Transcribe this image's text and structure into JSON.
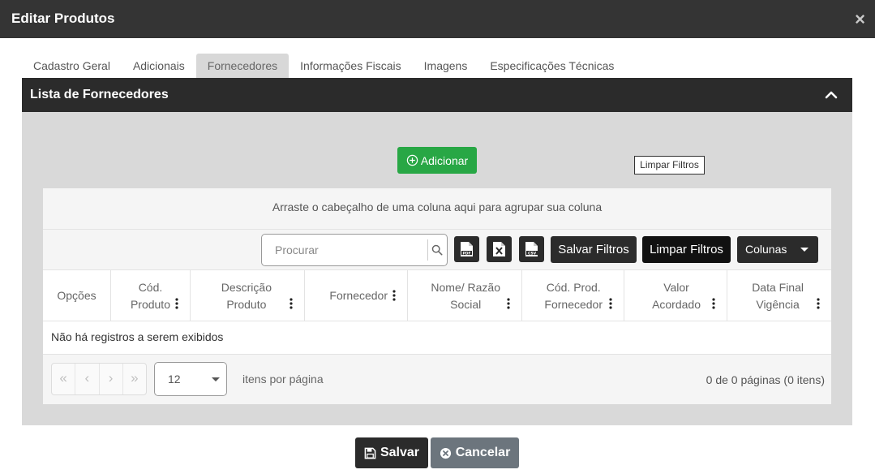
{
  "modal": {
    "title": "Editar Produtos",
    "close": "×"
  },
  "tabs": [
    {
      "label": "Cadastro Geral",
      "active": false
    },
    {
      "label": "Adicionais",
      "active": false
    },
    {
      "label": "Fornecedores",
      "active": true
    },
    {
      "label": "Informações Fiscais",
      "active": false
    },
    {
      "label": "Imagens",
      "active": false
    },
    {
      "label": "Especificações Técnicas",
      "active": false
    }
  ],
  "panel": {
    "title": "Lista de Fornecedores"
  },
  "actions": {
    "add_label": "Adicionar"
  },
  "grid": {
    "group_hint": "Arraste o cabeçalho de uma coluna aqui para agrupar sua coluna",
    "search_placeholder": "Procurar",
    "export_icons": [
      "pdf-icon",
      "excel-icon",
      "csv-icon"
    ],
    "save_filters": "Salvar Filtros",
    "clear_filters": "Limpar Filtros",
    "columns_button": "Colunas",
    "tooltip": "Limpar Filtros",
    "columns": [
      [
        "Opções"
      ],
      [
        "Cód.",
        "Produto"
      ],
      [
        "Descrição",
        "Produto"
      ],
      [
        "Fornecedor"
      ],
      [
        "Nome/ Razão",
        "Social"
      ],
      [
        "Cód. Prod.",
        "Fornecedor"
      ],
      [
        "Valor",
        "Acordado"
      ],
      [
        "Data Final",
        "Vigência"
      ]
    ],
    "empty_message": "Não há registros a serem exibidos",
    "pager": {
      "buttons": [
        "«",
        "‹",
        "›",
        "»"
      ],
      "page_size": "12",
      "page_size_label": "itens por página",
      "info": "0 de 0 páginas (0 itens)"
    }
  },
  "footer": {
    "save": "Salvar",
    "cancel": "Cancelar"
  },
  "colors": {
    "header": "#343434",
    "success": "#28a745",
    "secondary": "#6c757d"
  }
}
